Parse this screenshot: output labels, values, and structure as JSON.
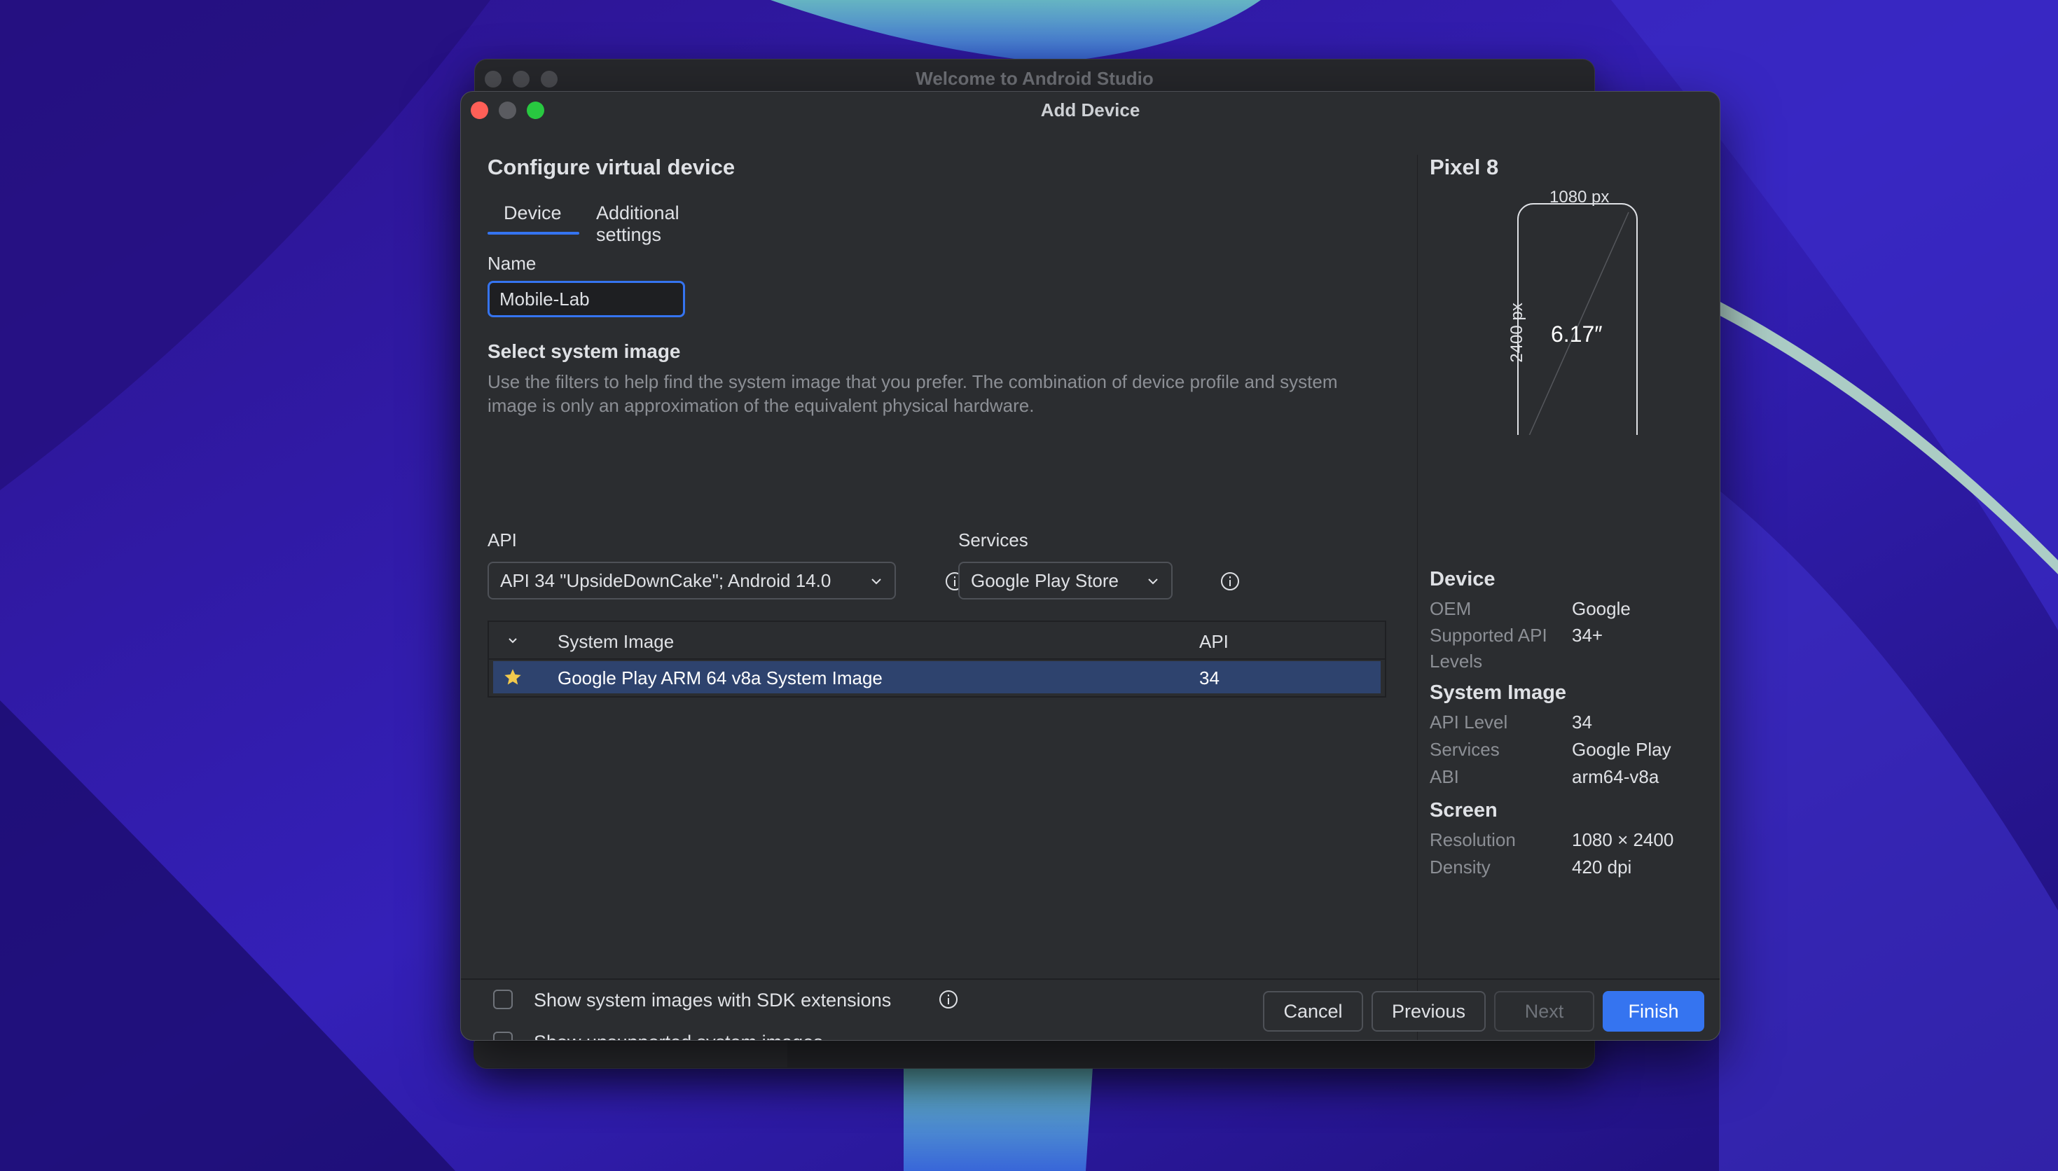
{
  "background_window": {
    "title": "Welcome to Android Studio"
  },
  "dialog": {
    "title": "Add Device",
    "heading": "Configure virtual device",
    "tabs": [
      {
        "label": "Device",
        "selected": true
      },
      {
        "label": "Additional settings",
        "selected": false
      }
    ],
    "name": {
      "label": "Name",
      "value": "Mobile-Lab"
    },
    "system_image": {
      "heading": "Select system image",
      "description": "Use the filters to help find the system image that you prefer. The combination of device profile and system image is only an approximation of the equivalent physical hardware.",
      "api_filter": {
        "label": "API",
        "value": "API 34 \"UpsideDownCake\"; Android 14.0"
      },
      "services_filter": {
        "label": "Services",
        "value": "Google Play Store"
      },
      "table": {
        "columns": [
          "System Image",
          "API"
        ],
        "rows": [
          {
            "name": "Google Play ARM 64 v8a System Image",
            "api": "34",
            "starred": true,
            "selected": true
          }
        ]
      },
      "options": [
        {
          "label": "Show system images with SDK extensions",
          "checked": false,
          "has_info": true
        },
        {
          "label": "Show unsupported system images",
          "checked": false,
          "has_info": false
        }
      ]
    },
    "buttons": {
      "cancel": "Cancel",
      "previous": "Previous",
      "next": "Next",
      "finish": "Finish"
    }
  },
  "preview": {
    "device_name": "Pixel 8",
    "width_label": "1080 px",
    "height_label": "2400 px",
    "diagonal_label": "6.17″",
    "sections": {
      "device": {
        "title": "Device",
        "oem_key": "OEM",
        "oem_val": "Google",
        "api_key": "Supported API Levels",
        "api_val": "34+"
      },
      "system_image": {
        "title": "System Image",
        "level_key": "API Level",
        "level_val": "34",
        "services_key": "Services",
        "services_val": "Google Play",
        "abi_key": "ABI",
        "abi_val": "arm64-v8a"
      },
      "screen": {
        "title": "Screen",
        "res_key": "Resolution",
        "res_val": "1080 × 2400",
        "density_key": "Density",
        "density_val": "420 dpi"
      }
    }
  },
  "colors": {
    "accent": "#3574f0",
    "dialog_bg": "#2b2d30",
    "selected_row": "#2e436e",
    "star": "#f2c94c"
  }
}
